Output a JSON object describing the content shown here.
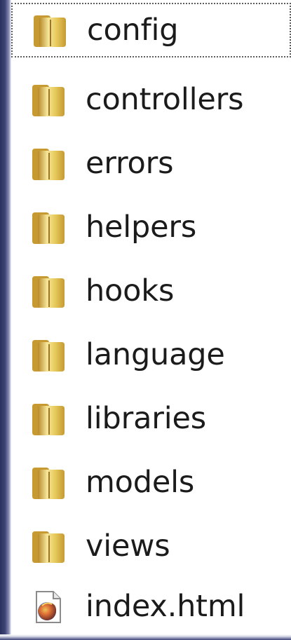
{
  "file_list": {
    "items": [
      {
        "label": "config",
        "icon": "folder-icon",
        "selected": true
      },
      {
        "label": "controllers",
        "icon": "folder-icon",
        "selected": false
      },
      {
        "label": "errors",
        "icon": "folder-icon",
        "selected": false
      },
      {
        "label": "helpers",
        "icon": "folder-icon",
        "selected": false
      },
      {
        "label": "hooks",
        "icon": "folder-icon",
        "selected": false
      },
      {
        "label": "language",
        "icon": "folder-icon",
        "selected": false
      },
      {
        "label": "libraries",
        "icon": "folder-icon",
        "selected": false
      },
      {
        "label": "models",
        "icon": "folder-icon",
        "selected": false
      },
      {
        "label": "views",
        "icon": "folder-icon",
        "selected": false
      },
      {
        "label": "index.html",
        "icon": "html-file-icon",
        "selected": false
      }
    ]
  },
  "colors": {
    "folder_light": "#f6e79a",
    "folder_mid": "#e7c95b",
    "folder_dark": "#b8892a",
    "text": "#1b1b1b",
    "focus_border": "#5d5d5d",
    "side_bar": "#2b315c"
  }
}
